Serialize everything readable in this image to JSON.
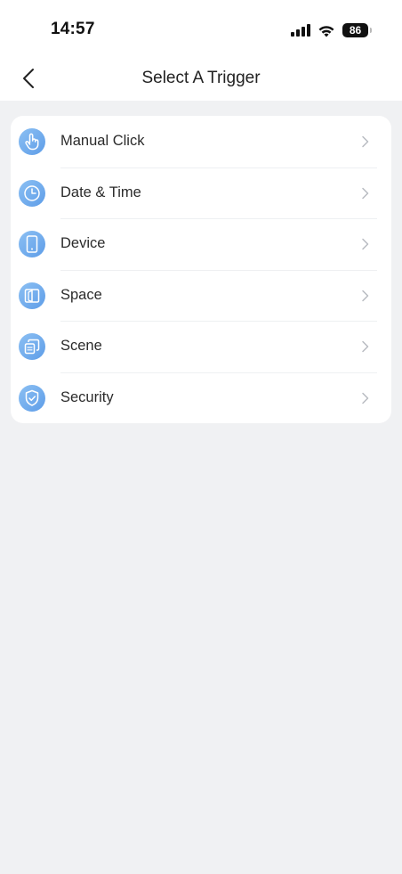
{
  "status_bar": {
    "time": "14:57",
    "battery": "86",
    "icons": [
      "signal-icon",
      "wifi-icon",
      "battery-icon"
    ]
  },
  "header": {
    "title": "Select A Trigger",
    "back_icon": "chevron-left-icon"
  },
  "triggers": [
    {
      "label": "Manual Click",
      "icon": "hand-click-icon"
    },
    {
      "label": "Date & Time",
      "icon": "clock-icon"
    },
    {
      "label": "Device",
      "icon": "phone-device-icon"
    },
    {
      "label": "Space",
      "icon": "door-space-icon"
    },
    {
      "label": "Scene",
      "icon": "scene-layers-icon"
    },
    {
      "label": "Security",
      "icon": "shield-check-icon"
    }
  ],
  "colors": {
    "background": "#f0f1f3",
    "card": "#ffffff",
    "icon_blue_light": "#8cc0f3",
    "icon_blue_dark": "#5e9de8",
    "chevron": "#b8bcc2"
  }
}
